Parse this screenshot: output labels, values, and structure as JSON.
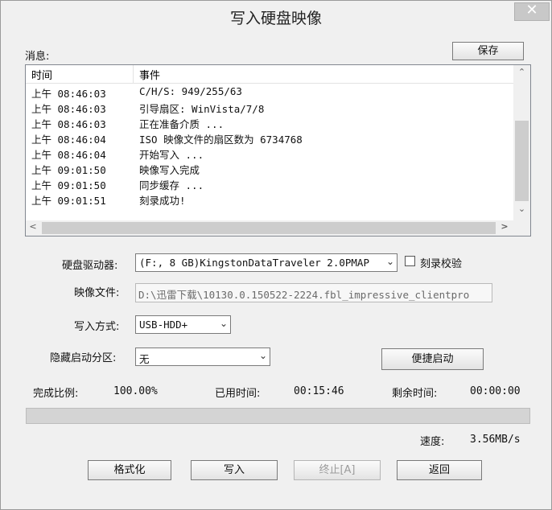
{
  "window": {
    "title": "写入硬盘映像",
    "close_glyph": "✕"
  },
  "messages": {
    "label": "消息:",
    "save_button": "保存",
    "columns": {
      "time": "时间",
      "event": "事件"
    },
    "rows": [
      {
        "time": "上午 08:46:03",
        "event": "C/H/S: 949/255/63"
      },
      {
        "time": "上午 08:46:03",
        "event": "引导扇区: WinVista/7/8"
      },
      {
        "time": "上午 08:46:03",
        "event": "正在准备介质 ..."
      },
      {
        "time": "上午 08:46:04",
        "event": "ISO 映像文件的扇区数为 6734768"
      },
      {
        "time": "上午 08:46:04",
        "event": "开始写入 ..."
      },
      {
        "time": "上午 09:01:50",
        "event": "映像写入完成"
      },
      {
        "time": "上午 09:01:50",
        "event": "同步缓存 ..."
      },
      {
        "time": "上午 09:01:51",
        "event": "刻录成功!"
      }
    ],
    "scroll_up": "⌃",
    "scroll_down": "⌄",
    "scroll_left": "<",
    "scroll_right": ">"
  },
  "drive": {
    "label": "硬盘驱动器:",
    "value": "(F:, 8 GB)KingstonDataTraveler 2.0PMAP",
    "verify_label": "刻录校验",
    "verify_checked": false
  },
  "image_file": {
    "label": "映像文件:",
    "value": "D:\\迅雷下载\\10130.0.150522-2224.fbl_impressive_clientpro"
  },
  "write_mode": {
    "label": "写入方式:",
    "value": "USB-HDD+"
  },
  "hidden_partition": {
    "label": "隐藏启动分区:",
    "value": "无"
  },
  "quick_boot_button": "便捷启动",
  "stats": {
    "ratio_label": "完成比例:",
    "ratio_value": "100.00%",
    "elapsed_label": "已用时间:",
    "elapsed_value": "00:15:46",
    "remaining_label": "剩余时间:",
    "remaining_value": "00:00:00",
    "speed_label": "速度:",
    "speed_value": "3.56MB/s"
  },
  "progress": {
    "fraction": 1.0
  },
  "buttons": {
    "format": "格式化",
    "write": "写入",
    "stop": "终止[A]",
    "back": "返回"
  }
}
